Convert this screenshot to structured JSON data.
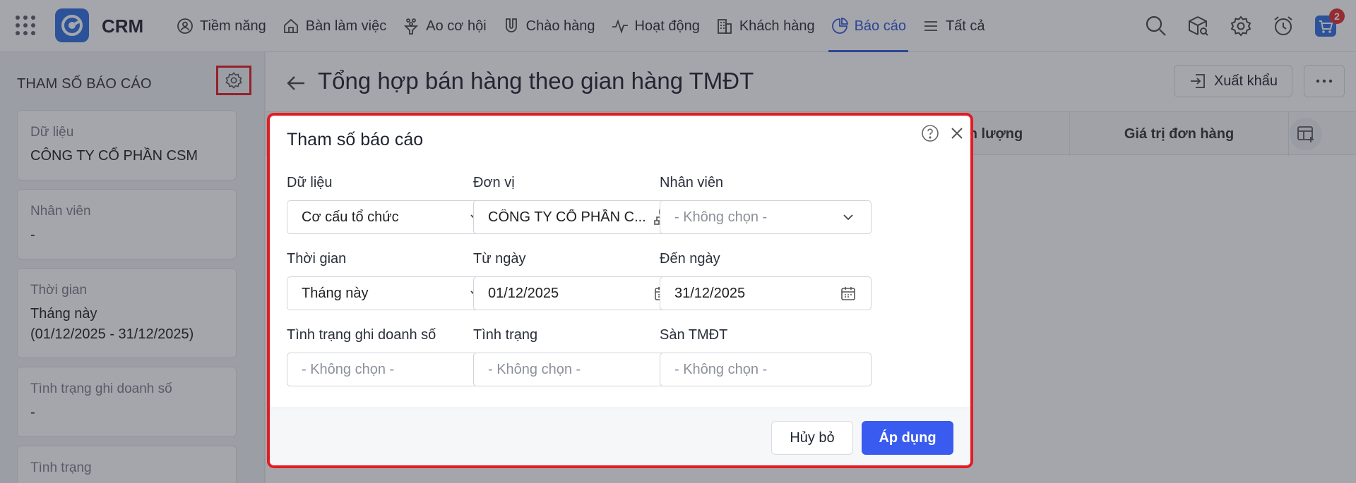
{
  "app": {
    "brand": "CRM",
    "cart_badge": "2",
    "accent": "#3459d6"
  },
  "nav": {
    "items": [
      {
        "label": "Tiềm năng",
        "icon": "user-circle-icon"
      },
      {
        "label": "Bàn làm việc",
        "icon": "home-icon"
      },
      {
        "label": "Ao cơ hội",
        "icon": "funnel-icon"
      },
      {
        "label": "Chào hàng",
        "icon": "magnet-icon"
      },
      {
        "label": "Hoạt động",
        "icon": "activity-icon"
      },
      {
        "label": "Khách hàng",
        "icon": "building-icon"
      },
      {
        "label": "Báo cáo",
        "icon": "pie-chart-icon",
        "active": true
      },
      {
        "label": "Tất cả",
        "icon": "menu-icon"
      }
    ]
  },
  "left_panel": {
    "title": "THAM SỐ BÁO CÁO",
    "cards": [
      {
        "label": "Dữ liệu",
        "value": "CÔNG TY CỔ PHẦN CSM"
      },
      {
        "label": "Nhân viên",
        "value": "-"
      },
      {
        "label": "Thời gian",
        "value": "Tháng này",
        "value2": "(01/12/2025 - 31/12/2025)"
      },
      {
        "label": "Tình trạng ghi doanh số",
        "value": "-"
      },
      {
        "label": "Tình trạng",
        "value": ""
      }
    ]
  },
  "page": {
    "title": "Tổng hợp bán hàng theo gian hàng TMĐT",
    "export_label": "Xuất khẩu",
    "columns": [
      "n lượng",
      "Giá trị đơn hàng"
    ]
  },
  "dialog": {
    "title": "Tham số báo cáo",
    "fields": {
      "du_lieu": {
        "label": "Dữ liệu",
        "value": "Cơ cấu tổ chức"
      },
      "don_vi": {
        "label": "Đơn vị",
        "value": "CÔNG TY CỔ PHẦN C..."
      },
      "nhan_vien": {
        "label": "Nhân viên",
        "placeholder": "- Không chọn -"
      },
      "thoi_gian": {
        "label": "Thời gian",
        "value": "Tháng này"
      },
      "tu_ngay": {
        "label": "Từ ngày",
        "value": "01/12/2025"
      },
      "den_ngay": {
        "label": "Đến ngày",
        "value": "31/12/2025"
      },
      "tinh_trang_ghi_ds": {
        "label": "Tình trạng ghi doanh số",
        "placeholder": "- Không chọn -"
      },
      "tinh_trang": {
        "label": "Tình trạng",
        "placeholder": "- Không chọn -"
      },
      "san_tmdt": {
        "label": "Sàn TMĐT",
        "placeholder": "- Không chọn -"
      }
    },
    "cancel_label": "Hủy bỏ",
    "apply_label": "Áp dụng"
  }
}
